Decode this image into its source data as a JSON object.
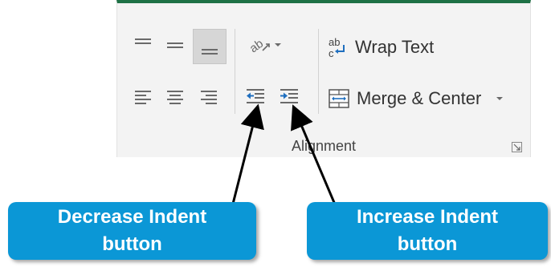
{
  "ribbon": {
    "group_name": "Alignment",
    "wrap_text_label": "Wrap Text",
    "merge_center_label": "Merge & Center"
  },
  "callouts": {
    "decrease": {
      "line1": "Decrease Indent",
      "line2": "button"
    },
    "increase": {
      "line1": "Increase Indent",
      "line2": "button"
    }
  },
  "colors": {
    "ribbon_bg": "#f3f3f3",
    "accent_top": "#1e7145",
    "callout_bg": "#0b97d6",
    "indent_arrow": "#1f6fbf"
  },
  "icons": [
    "top-align-icon",
    "middle-align-icon",
    "bottom-align-icon",
    "orientation-icon",
    "chevron-down-icon",
    "wrap-text-icon",
    "align-left-icon",
    "center-icon",
    "align-right-icon",
    "decrease-indent-icon",
    "increase-indent-icon",
    "merge-center-icon",
    "dialog-launcher-icon"
  ]
}
